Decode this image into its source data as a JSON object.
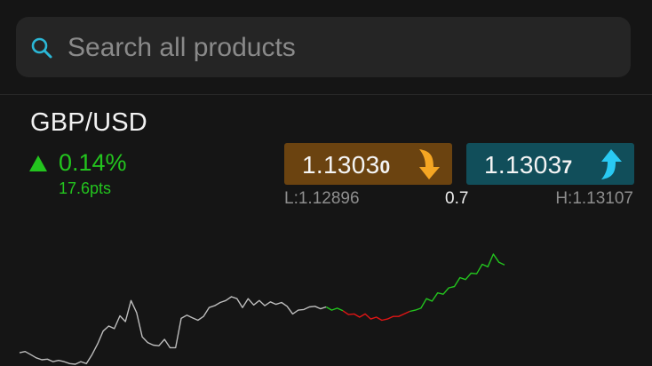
{
  "search": {
    "placeholder": "Search all products"
  },
  "instrument": {
    "name": "GBP/USD",
    "change_percent": "0.14%",
    "change_points": "17.6pts",
    "direction": "up"
  },
  "quote": {
    "sell": {
      "main": "1.1303",
      "pip": "0"
    },
    "buy": {
      "main": "1.1303",
      "pip": "7"
    },
    "low": "L:1.12896",
    "spread": "0.7",
    "high": "H:1.13107"
  },
  "colors": {
    "up": "#23c41e",
    "down": "#e01515",
    "neutral_line": "#bdbdbd",
    "sell_bg": "#6b4310",
    "sell_arrow": "#f5a623",
    "buy_bg": "#114e5a",
    "buy_arrow": "#29c9f2",
    "search_icon": "#2bb7d6"
  },
  "icons": {
    "search": "search-icon",
    "change": "triangle-up-icon",
    "sell": "arrow-down-curved-icon",
    "buy": "arrow-up-curved-icon"
  },
  "chart_data": {
    "type": "line",
    "y": [
      1.12914,
      1.12916,
      1.12911,
      1.12906,
      1.12903,
      1.12904,
      1.129,
      1.12902,
      1.129,
      1.12897,
      1.12896,
      1.129,
      1.12897,
      1.12911,
      1.12928,
      1.12948,
      1.12956,
      1.12952,
      1.12972,
      1.12963,
      1.12996,
      1.12977,
      1.12939,
      1.1293,
      1.12926,
      1.12925,
      1.12935,
      1.12922,
      1.12922,
      1.12968,
      1.12973,
      1.12969,
      1.12965,
      1.12971,
      1.12985,
      1.12988,
      1.12993,
      1.12996,
      1.13002,
      1.12999,
      1.12985,
      1.12999,
      1.12989,
      1.12996,
      1.12988,
      1.12994,
      1.1299,
      1.12993,
      1.12987,
      1.12975,
      1.12981,
      1.12982,
      1.12986,
      1.12987,
      1.12983,
      1.12986,
      1.12981,
      1.12984,
      1.1298,
      1.12974,
      1.12975,
      1.1297,
      1.12975,
      1.12967,
      1.1297,
      1.12965,
      1.12967,
      1.12971,
      1.12971,
      1.12975,
      1.12979,
      1.12981,
      1.12984,
      1.12999,
      1.12995,
      1.13008,
      1.13006,
      1.13016,
      1.13018,
      1.13032,
      1.13029,
      1.13039,
      1.13038,
      1.13053,
      1.13049,
      1.13069,
      1.13056,
      1.13052
    ],
    "segments": [
      {
        "from": 0,
        "to": 55,
        "trend": "neutral"
      },
      {
        "from": 55,
        "to": 58,
        "trend": "up"
      },
      {
        "from": 58,
        "to": 70,
        "trend": "down"
      },
      {
        "from": 70,
        "to": 87,
        "trend": "up"
      }
    ],
    "title": "",
    "xlabel": "",
    "ylabel": "",
    "grid": false,
    "legend": "none"
  }
}
